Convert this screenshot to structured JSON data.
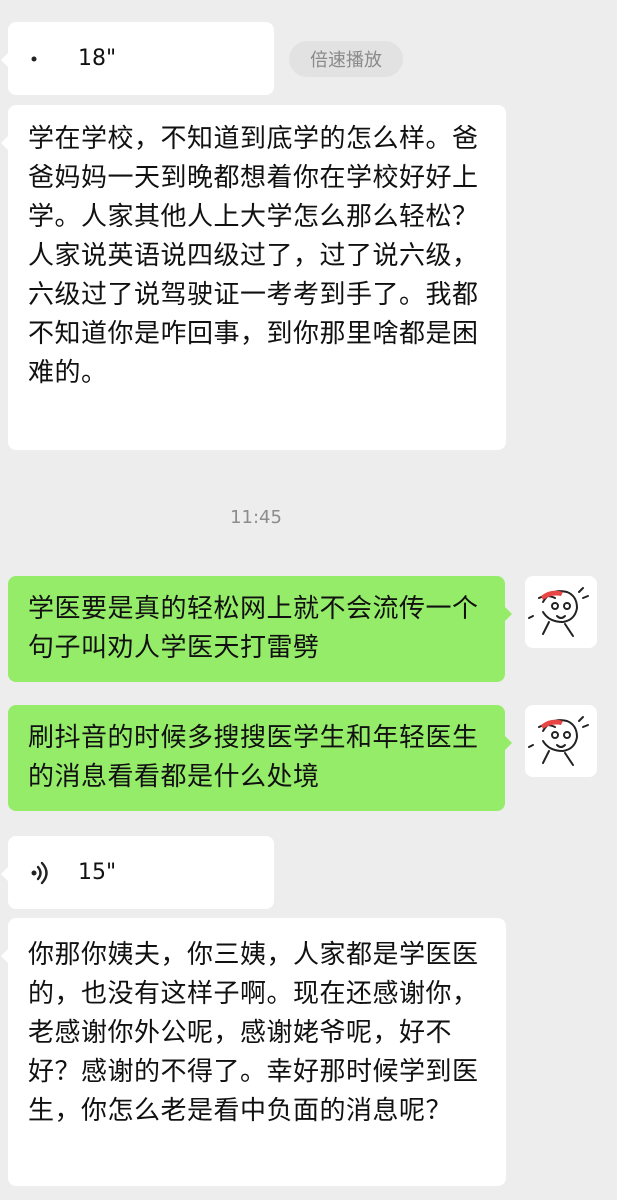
{
  "messages": [
    {
      "type": "voice",
      "side": "left",
      "duration": "18\""
    },
    {
      "type": "speed_button",
      "label": "倍速播放"
    },
    {
      "type": "text",
      "side": "left",
      "text": "学在学校，不知道到底学的怎么样。爸爸妈妈一天到晚都想着你在学校好好上学。人家其他人上大学怎么那么轻松？人家说英语说四级过了，过了说六级，六级过了说驾驶证一考考到手了。我都不知道你是咋回事，到你那里啥都是困难的。"
    },
    {
      "type": "time",
      "text": "11:45"
    },
    {
      "type": "text",
      "side": "right",
      "text": "学医要是真的轻松网上就不会流传一个句子叫劝人学医天打雷劈"
    },
    {
      "type": "text",
      "side": "right",
      "text": "刷抖音的时候多搜搜医学生和年轻医生的消息看看都是什么处境"
    },
    {
      "type": "voice",
      "side": "left",
      "duration": "15\""
    },
    {
      "type": "text",
      "side": "left",
      "text": "你那你姨夫，你三姨，人家都是学医医的，也没有这样子啊。现在还感谢你，老感谢你外公呢，感谢姥爷呢，好不好？感谢的不得了。幸好那时候学到医生，你怎么老是看中负面的消息呢？"
    }
  ],
  "icons": {
    "voice": "voice-wave-icon",
    "avatar": "cartoon-avatar"
  },
  "colors": {
    "background": "#ededed",
    "sent_bubble": "#95ec69",
    "received_bubble": "#ffffff"
  }
}
